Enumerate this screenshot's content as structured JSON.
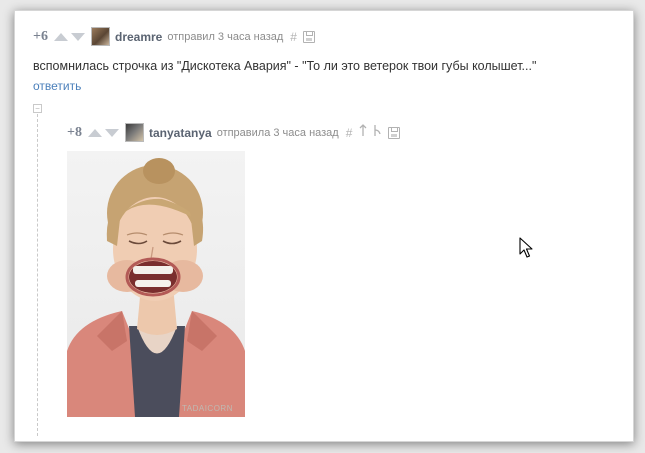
{
  "comment": {
    "rating": "+6",
    "username": "dreamre",
    "meta": "отправил 3 часа назад",
    "text": "вспомнилась строчка из \"Дискотека Авария\" - \"То ли это ветерок твои губы колышет...\"",
    "reply_label": "ответить"
  },
  "reply": {
    "rating": "+8",
    "username": "tanyatanya",
    "meta": "отправила 3 часа назад",
    "watermark": "TADAICORN"
  },
  "icons": {
    "hash": "#",
    "collapse": "−"
  }
}
